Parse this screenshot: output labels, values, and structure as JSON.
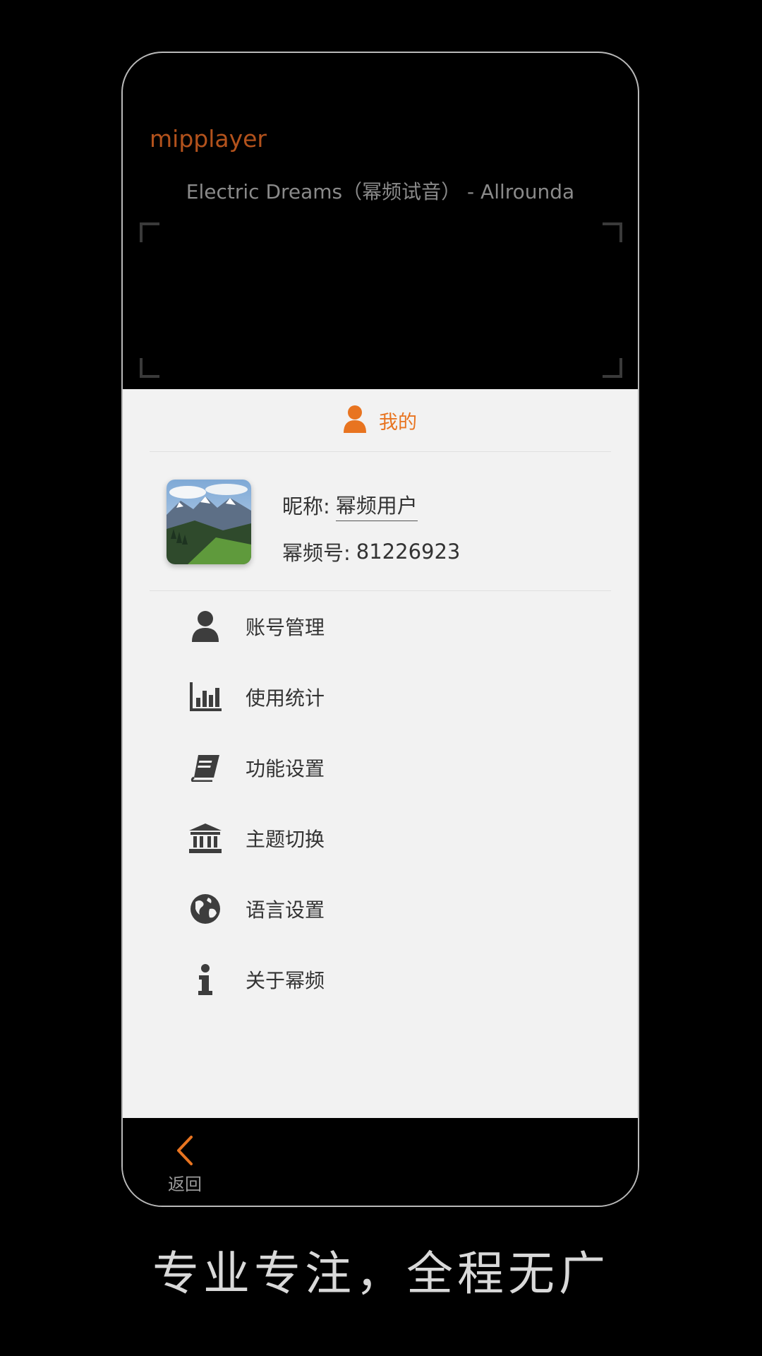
{
  "app": {
    "brand": "mipplayer"
  },
  "player": {
    "track_title": "Electric Dreams（幂频试音） - Allrounda"
  },
  "panel": {
    "header_title": "我的",
    "profile": {
      "nickname_label": "昵称:",
      "nickname_value": "幂频用户",
      "id_label": "幂频号:",
      "id_value": "81226923"
    },
    "menu": [
      {
        "label": "账号管理",
        "icon": "user-icon"
      },
      {
        "label": "使用统计",
        "icon": "bar-chart-icon"
      },
      {
        "label": "功能设置",
        "icon": "book-icon"
      },
      {
        "label": "主题切换",
        "icon": "bank-icon"
      },
      {
        "label": "语言设置",
        "icon": "globe-icon"
      },
      {
        "label": "关于幂频",
        "icon": "info-icon"
      }
    ]
  },
  "bottom": {
    "back_label": "返回"
  },
  "slogan": "专业专注，全程无广",
  "colors": {
    "accent": "#e87420",
    "brand": "#b3521c",
    "wave": "#5b8a35"
  }
}
